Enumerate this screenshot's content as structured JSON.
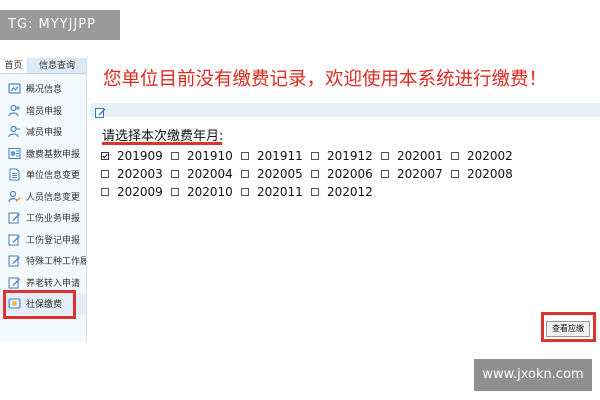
{
  "watermarks": {
    "top": "TG: MYYJJPP",
    "bottom": "www.jxokn.com"
  },
  "sidebar": {
    "tabs": [
      {
        "label": "首页"
      },
      {
        "label": "信息查询"
      }
    ],
    "items": [
      {
        "label": "概况信息",
        "icon": "overview-icon"
      },
      {
        "label": "增员申报",
        "icon": "person-add-icon"
      },
      {
        "label": "减员申报",
        "icon": "person-remove-icon"
      },
      {
        "label": "缴费基数申报",
        "icon": "form-icon"
      },
      {
        "label": "单位信息变更",
        "icon": "document-icon"
      },
      {
        "label": "人员信息变更",
        "icon": "person-edit-icon"
      },
      {
        "label": "工伤业务申报",
        "icon": "edit-icon"
      },
      {
        "label": "工伤登记申报",
        "icon": "edit-icon"
      },
      {
        "label": "特殊工种工作履",
        "icon": "edit-icon"
      },
      {
        "label": "养老转入申请",
        "icon": "edit-icon"
      },
      {
        "label": "社保缴费",
        "icon": "payment-icon",
        "active": true
      }
    ]
  },
  "main": {
    "heading": "您单位目前没有缴费记录，欢迎使用本系统进行缴费！",
    "prompt": "请选择本次缴费年月:",
    "months": [
      {
        "label": "201909",
        "checked": true
      },
      {
        "label": "201910",
        "checked": false
      },
      {
        "label": "201911",
        "checked": false
      },
      {
        "label": "201912",
        "checked": false
      },
      {
        "label": "202001",
        "checked": false
      },
      {
        "label": "202002",
        "checked": false
      },
      {
        "label": "202003",
        "checked": false
      },
      {
        "label": "202004",
        "checked": false
      },
      {
        "label": "202005",
        "checked": false
      },
      {
        "label": "202006",
        "checked": false
      },
      {
        "label": "202007",
        "checked": false
      },
      {
        "label": "202008",
        "checked": false
      },
      {
        "label": "202009",
        "checked": false
      },
      {
        "label": "202010",
        "checked": false
      },
      {
        "label": "202011",
        "checked": false
      },
      {
        "label": "202012",
        "checked": false
      }
    ],
    "query_button": "查看应缴"
  },
  "colors": {
    "accent_red": "#e02a20",
    "highlight_red": "#e0312f",
    "sidebar_bg": "#f4f9fd"
  }
}
